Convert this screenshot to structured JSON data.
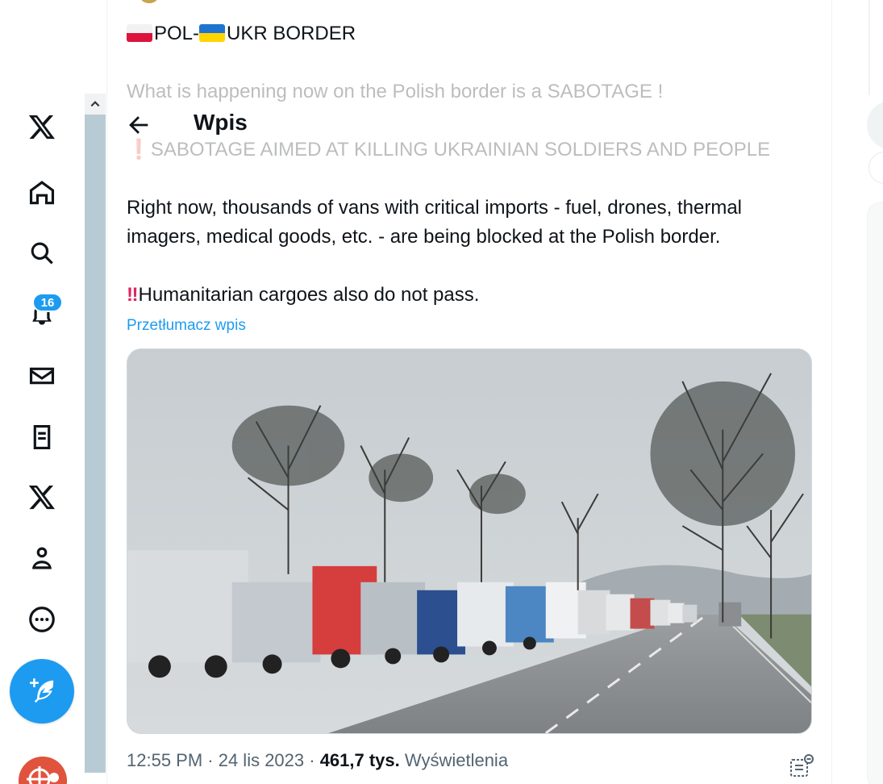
{
  "app": "X",
  "nav": {
    "notification_count": "16",
    "items": [
      "x-logo",
      "home-icon",
      "search-icon",
      "bell-icon",
      "mail-icon",
      "lists-icon",
      "x-premium-icon",
      "profile-icon",
      "more-icon"
    ]
  },
  "header": {
    "title": "Wpis"
  },
  "post": {
    "line1_text": "POL-",
    "line1_text2": "UKR BORDER",
    "line2": "What is happening now on the Polish border is a SABOTAGE !",
    "line3": "SABOTAGE AIMED AT KILLING UKRAINIAN SOLDIERS AND PEOPLE",
    "line4": "Right now, thousands of vans with critical imports - fuel, drones, thermal",
    "line5": "imagers, medical goods, etc. - are being blocked at the Polish border.",
    "line6_mark": "‼",
    "line6": "Humanitarian cargoes also do not pass.",
    "translate": "Przetłumacz wpis",
    "time": "12:55 PM · 24 lis 2023 · ",
    "views_count": "461,7 tys.",
    "views_label": " Wyświetlenia"
  },
  "colors": {
    "accent": "#1d9bf0",
    "text": "#0f1419",
    "muted": "#536471",
    "alert": "#e0245e"
  }
}
